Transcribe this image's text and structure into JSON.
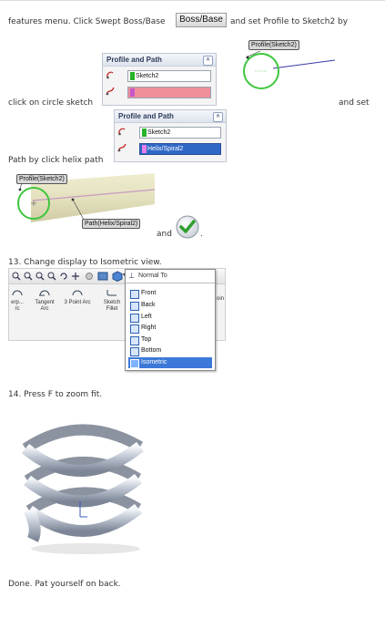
{
  "instructions": {
    "line1_a": "features menu. Click Swept Boss/Base",
    "line1_b": "and set Profile to Sketch2 by",
    "line2_a": "click on circle sketch",
    "line2_b": "and set",
    "line3": "Path by click helix path",
    "and_text": "and",
    "period": ".",
    "step13": "13. Change display to Isometric view.",
    "step14": "14. Press F to zoom fit.",
    "done": "Done. Pat yourself on back."
  },
  "boss_base_button": {
    "label": "Boss/Base"
  },
  "panel1": {
    "title": "Profile and Path",
    "profile_value": "Sketch2",
    "path_value": ""
  },
  "panel2": {
    "title": "Profile and Path",
    "profile_value": "Sketch2",
    "path_value": "Helix/Spiral2"
  },
  "sketch_tags": {
    "profile": "Profile(Sketch2)",
    "profile2": "Profile(Sketch2)",
    "path": "Path(Helix/Spiral2)"
  },
  "toolbar": {
    "tools": [
      "erp... rc",
      "Tangent Arc",
      "3 Point Arc",
      "Sketch Fillet"
    ],
    "tool_labels": {
      "t0a": "erp...",
      "t0b": "rc",
      "t1a": "Tangent",
      "t1b": "Arc",
      "t2a": "3 Point Arc",
      "t3a": "Sketch",
      "t3b": "Fillet",
      "t4": "oin"
    },
    "normal_to": "Normal To"
  },
  "view_menu": {
    "items": [
      "Front",
      "Back",
      "Left",
      "Right",
      "Top",
      "Bottom",
      "Isometric"
    ],
    "selected": "Isometric"
  },
  "colors": {
    "accent": "#3c78d8",
    "pink_field": "#f08f9a",
    "green_check": "#2e9e2e",
    "circle_green": "#3ec63e"
  },
  "icons": {
    "checkmark": "checkmark-icon",
    "menu_views": "view-cube-icon"
  }
}
